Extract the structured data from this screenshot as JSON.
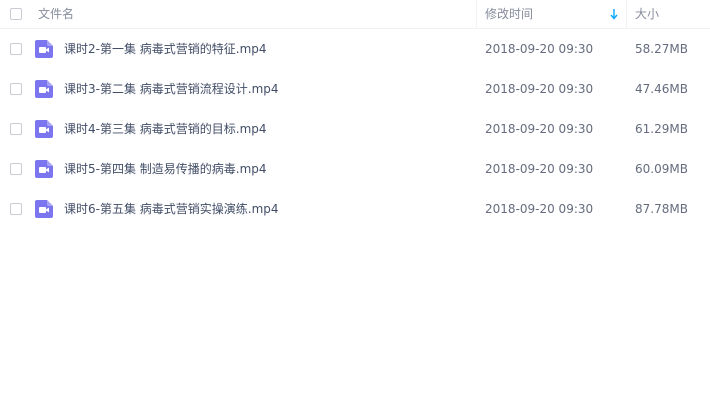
{
  "header": {
    "name_label": "文件名",
    "date_label": "修改时间",
    "size_label": "大小",
    "sort_icon": "arrow-down-icon"
  },
  "colors": {
    "accent": "#06a7ff",
    "video_icon": "#7b75f0"
  },
  "files": [
    {
      "icon": "video-file-icon",
      "name": "课时2-第一集 病毒式营销的特征.mp4",
      "modified": "2018-09-20 09:30",
      "size": "58.27MB"
    },
    {
      "icon": "video-file-icon",
      "name": "课时3-第二集 病毒式营销流程设计.mp4",
      "modified": "2018-09-20 09:30",
      "size": "47.46MB"
    },
    {
      "icon": "video-file-icon",
      "name": "课时4-第三集 病毒式营销的目标.mp4",
      "modified": "2018-09-20 09:30",
      "size": "61.29MB"
    },
    {
      "icon": "video-file-icon",
      "name": "课时5-第四集 制造易传播的病毒.mp4",
      "modified": "2018-09-20 09:30",
      "size": "60.09MB"
    },
    {
      "icon": "video-file-icon",
      "name": "课时6-第五集 病毒式营销实操演练.mp4",
      "modified": "2018-09-20 09:30",
      "size": "87.78MB"
    }
  ]
}
